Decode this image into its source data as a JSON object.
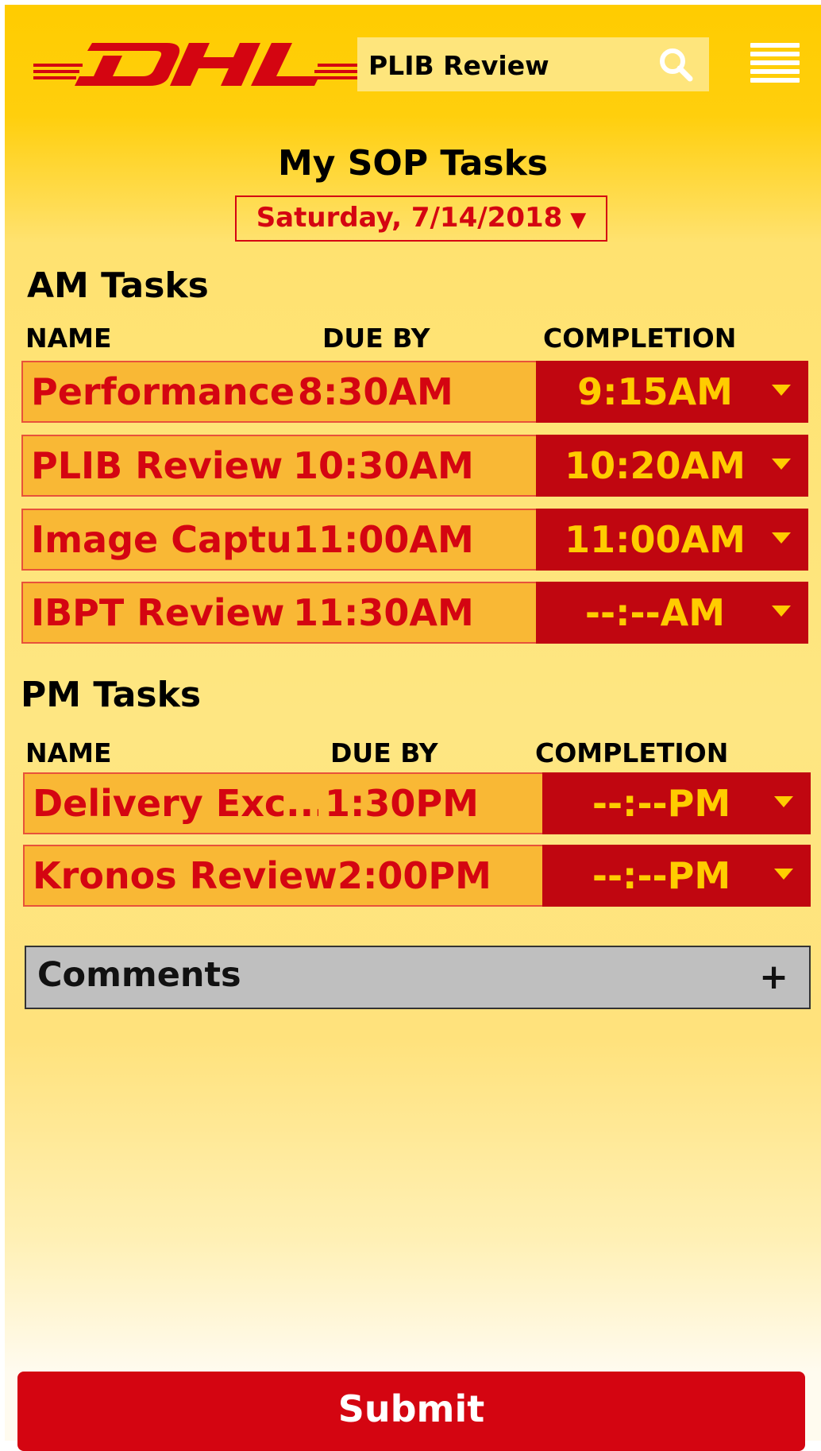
{
  "header": {
    "brand": "DHL",
    "search_value": "PLIB Review"
  },
  "page": {
    "title": "My SOP Tasks",
    "date": "Saturday, 7/14/2018"
  },
  "columns": {
    "name": "NAME",
    "due": "DUE BY",
    "completion": "COMPLETION"
  },
  "am": {
    "title": "AM Tasks",
    "tasks": [
      {
        "name": "Performance...",
        "due": "8:30AM",
        "completion": "9:15AM"
      },
      {
        "name": "PLIB Review",
        "due": "10:30AM",
        "completion": "10:20AM"
      },
      {
        "name": "Image Captu...",
        "due": "11:00AM",
        "completion": "11:00AM"
      },
      {
        "name": "IBPT Review",
        "due": "11:30AM",
        "completion": "--:--AM"
      }
    ]
  },
  "pm": {
    "title": "PM Tasks",
    "tasks": [
      {
        "name": "Delivery Exc...",
        "due": "1:30PM",
        "completion": "--:--PM"
      },
      {
        "name": "Kronos Review",
        "due": "2:00PM",
        "completion": "--:--PM"
      }
    ]
  },
  "comments": {
    "label": "Comments",
    "toggle": "+"
  },
  "submit_label": "Submit",
  "colors": {
    "dhl_yellow": "#ffcc00",
    "dhl_red": "#d40511",
    "row_fill": "#f9b835",
    "completion_fill": "#c00610"
  }
}
